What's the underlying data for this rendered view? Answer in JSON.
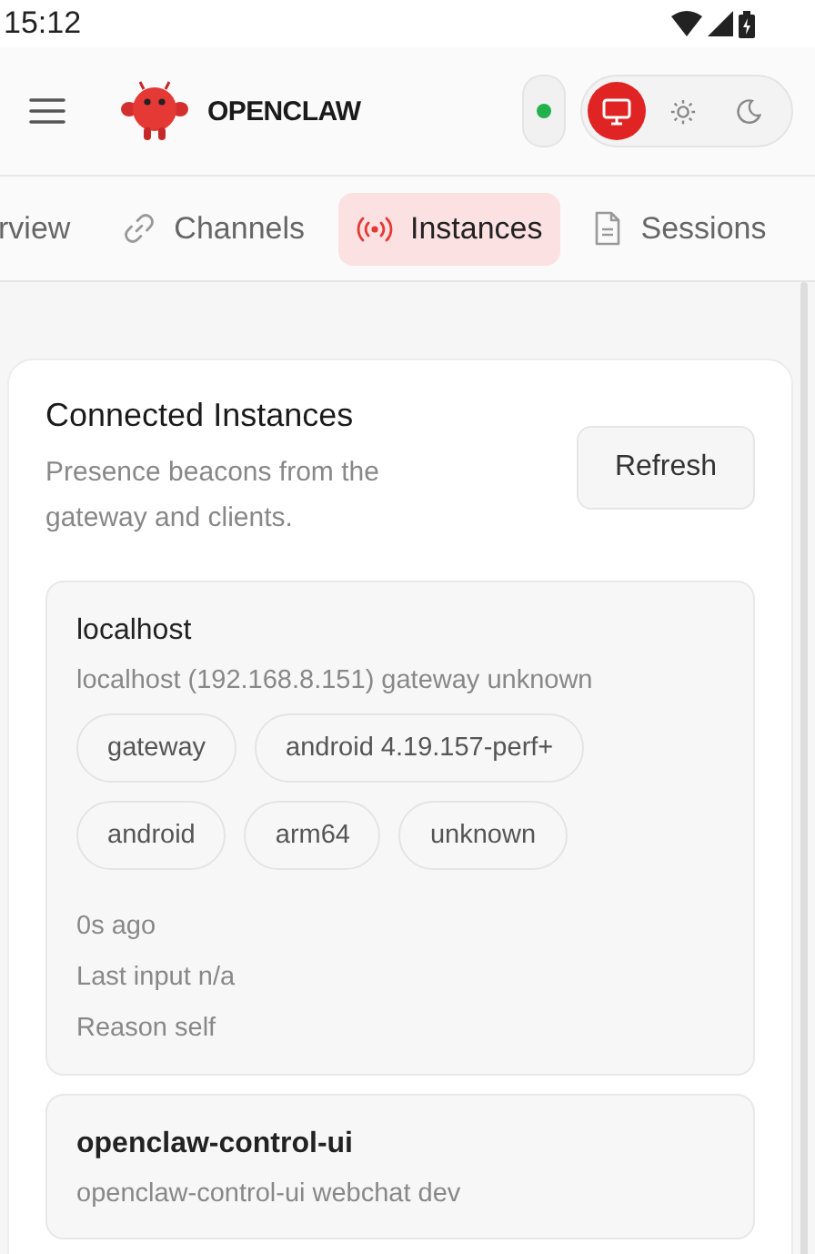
{
  "status_bar": {
    "time": "15:12"
  },
  "header": {
    "brand": "OPENCLAW",
    "connected": true,
    "theme_options": [
      {
        "kind": "system",
        "selected": true
      },
      {
        "kind": "light",
        "selected": false
      },
      {
        "kind": "dark",
        "selected": false
      }
    ]
  },
  "tabs": [
    {
      "label": "rview",
      "kind": "none",
      "selected": false
    },
    {
      "label": "Channels",
      "kind": "link",
      "selected": false
    },
    {
      "label": "Instances",
      "kind": "broadcast",
      "selected": true
    },
    {
      "label": "Sessions",
      "kind": "document",
      "selected": false
    }
  ],
  "panel": {
    "title": "Connected Instances",
    "subtitle": "Presence beacons from the gateway and clients.",
    "button": "Refresh",
    "instances": [
      {
        "name": "localhost",
        "detail": "localhost (192.168.8.151) gateway unknown",
        "chips": [
          "gateway",
          "android 4.19.157-perf+",
          "android",
          "arm64",
          "unknown"
        ],
        "meta": [
          "0s ago",
          "Last input n/a",
          "Reason self"
        ]
      },
      {
        "name": "openclaw-control-ui",
        "detail": "openclaw-control-ui webchat dev"
      }
    ]
  }
}
